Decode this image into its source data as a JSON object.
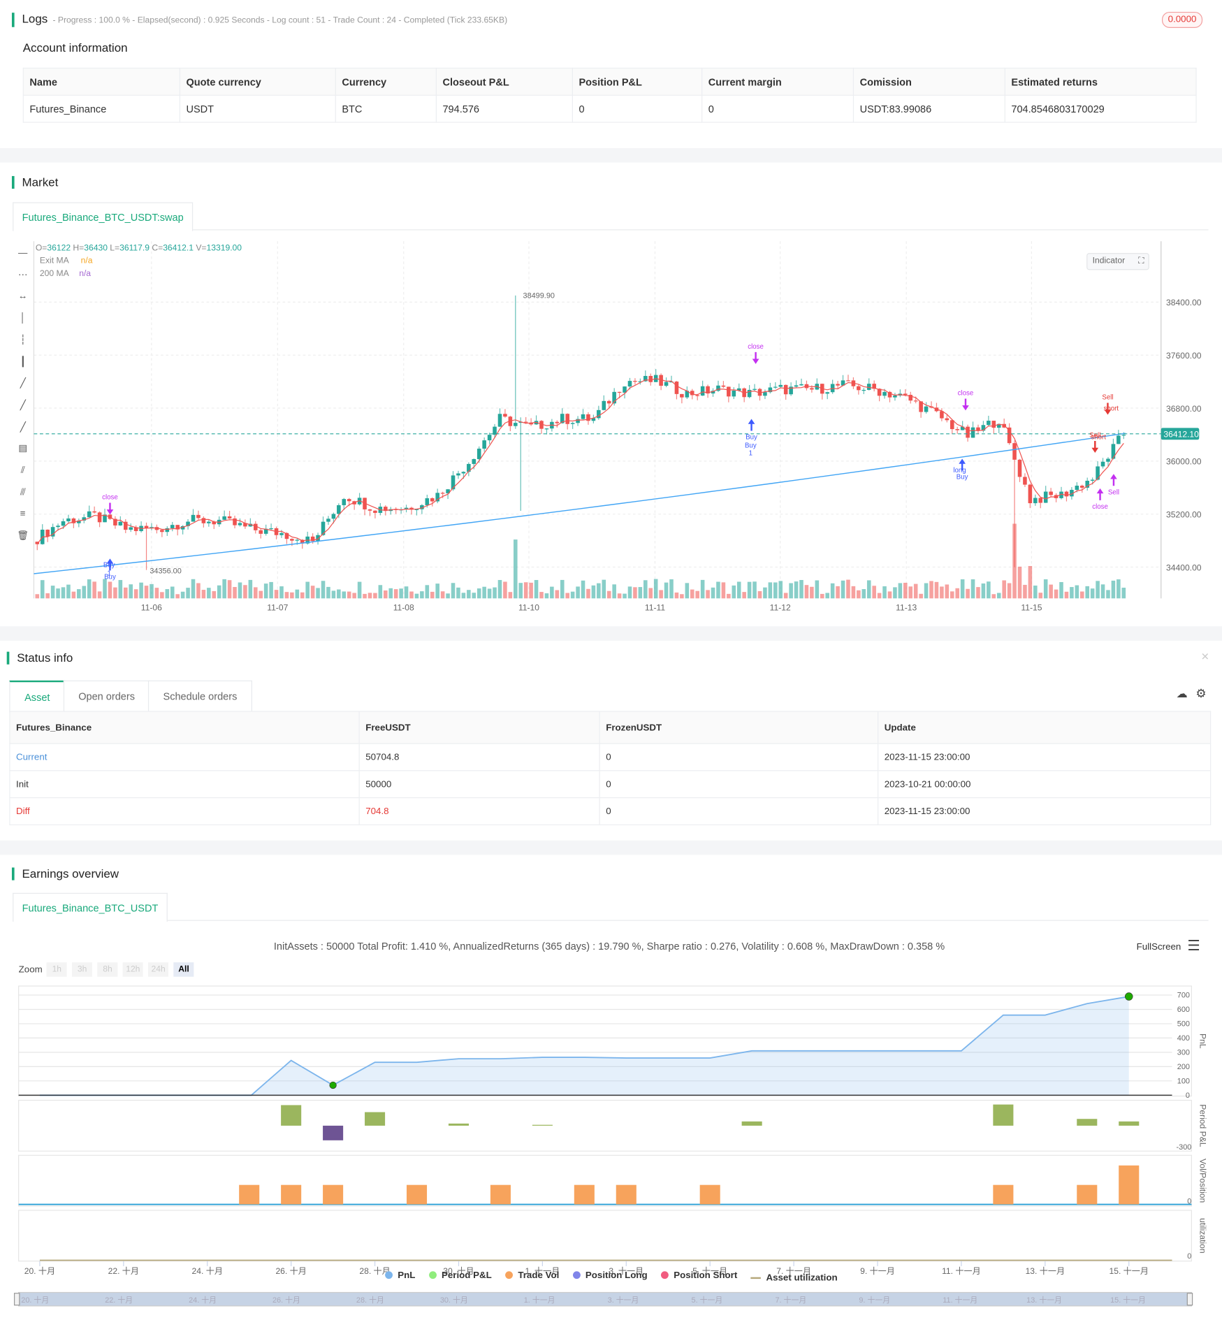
{
  "logs": {
    "title": "Logs",
    "summary": "- Progress : 100.0 % - Elapsed(second) : 0.925  Seconds - Log count : 51 - Trade Count : 24 - Completed (Tick 233.65KB)",
    "badge": "0.0000"
  },
  "account": {
    "title": "Account information",
    "headers": [
      "Name",
      "Quote currency",
      "Currency",
      "Closeout P&L",
      "Position P&L",
      "Current margin",
      "Comission",
      "Estimated returns"
    ],
    "row": [
      "Futures_Binance",
      "USDT",
      "BTC",
      "794.576",
      "0",
      "0",
      "USDT:83.99086",
      "704.8546803170029"
    ]
  },
  "market": {
    "title": "Market",
    "tab": "Futures_Binance_BTC_USDT:swap",
    "ohlc": {
      "o_label": "O=",
      "o": "36122",
      "h_label": "H=",
      "h": "36430",
      "l_label": "L=",
      "l": "36117.9",
      "c_label": "C=",
      "c": "36412.1",
      "v_label": "V=",
      "v": "13319.00"
    },
    "legend": [
      {
        "name": "Exit MA",
        "value": "n/a",
        "color": "#f5a623"
      },
      {
        "name": "200 MA",
        "value": "n/a",
        "color": "#a66bd3"
      }
    ],
    "indicator_button": "Indicator",
    "last_price": "36412.10",
    "max_label": "38499.90",
    "min_label": "34356.00",
    "markers": [
      "Buy",
      "long",
      "1",
      "close",
      "short",
      "Sell"
    ]
  },
  "chart_data": {
    "type": "candlestick",
    "title": "Futures_Binance_BTC_USDT:swap",
    "x_ticks": [
      "11-06",
      "11-07",
      "11-08",
      "11-10",
      "11-11",
      "11-12",
      "11-13",
      "11-15"
    ],
    "y_ticks": [
      34400,
      35200,
      36000,
      36800,
      37600,
      38400
    ],
    "ylim": [
      34000,
      38900
    ],
    "closes_6h": [
      34783,
      35100,
      35167,
      34975,
      34975,
      35100,
      35100,
      34975,
      34911,
      34783,
      35486,
      35294,
      35294,
      35486,
      35997,
      36636,
      36509,
      36636,
      36636,
      37211,
      37211,
      37020,
      37084,
      37020,
      37084,
      37084,
      37148,
      37084,
      36956,
      36700,
      36381,
      36636,
      35422,
      35486,
      35742,
      36412
    ],
    "ma200_start": 34300,
    "ma200_end": 36420,
    "series": [
      {
        "name": "Exit MA",
        "color": "#ef5350"
      },
      {
        "name": "200 MA",
        "color": "#42a5f5"
      }
    ],
    "colors": {
      "up": "#26a69a",
      "down": "#ef5350"
    }
  },
  "status": {
    "title": "Status info",
    "tabs": [
      "Asset",
      "Open orders",
      "Schedule orders"
    ],
    "headers": [
      "Futures_Binance",
      "FreeUSDT",
      "FrozenUSDT",
      "Update"
    ],
    "rows": [
      [
        "Current",
        "50704.8",
        "0",
        "2023-11-15 23:00:00"
      ],
      [
        "Init",
        "50000",
        "0",
        "2023-10-21 00:00:00"
      ],
      [
        "Diff",
        "704.8",
        "0",
        "2023-11-15 23:00:00"
      ]
    ]
  },
  "earnings": {
    "title": "Earnings overview",
    "tab": "Futures_Binance_BTC_USDT",
    "summary": "InitAssets : 50000 Total Profit: 1.410 %, AnnualizedReturns (365 days) : 19.790 %, Sharpe ratio : 0.276, Volatility : 0.608 %, MaxDrawDown : 0.358 %",
    "fullscreen": "FullScreen",
    "zoom_label": "Zoom",
    "zoom_options": [
      "1h",
      "3h",
      "8h",
      "12h",
      "24h",
      "All"
    ],
    "axis_titles": [
      "PnL",
      "Period P&L",
      "Vol/Position",
      "utilization"
    ],
    "pnl_ticks": [
      "700",
      "600",
      "500",
      "400",
      "300",
      "200",
      "100",
      "0"
    ],
    "period_tick": "-300",
    "vol_tick": "0",
    "util_tick": "0",
    "x_ticks": [
      "20. 十月",
      "22. 十月",
      "24. 十月",
      "26. 十月",
      "28. 十月",
      "30. 十月",
      "1. 十一月",
      "3. 十一月",
      "5. 十一月",
      "7. 十一月",
      "9. 十一月",
      "11. 十一月",
      "13. 十一月",
      "15. 十一月"
    ],
    "legend": [
      {
        "name": "PnL",
        "color": "#7cb5ec"
      },
      {
        "name": "Period P&L",
        "color": "#90ed7d"
      },
      {
        "name": "Trade Vol",
        "color": "#f7a35c"
      },
      {
        "name": "Position Long",
        "color": "#8085e9"
      },
      {
        "name": "Position Short",
        "color": "#f15c80"
      },
      {
        "name": "Asset utilization",
        "color": "#b5a77a"
      }
    ]
  },
  "earnings_chart": {
    "type": "line",
    "pnl": {
      "days": [
        0,
        1,
        2,
        3,
        4,
        5,
        5.05,
        6,
        7,
        8,
        9,
        10,
        11,
        12,
        13,
        14,
        15,
        16,
        17,
        18,
        19,
        20,
        21,
        22,
        23,
        24,
        25,
        26
      ],
      "values": [
        0,
        0,
        0,
        0,
        0,
        0,
        0,
        243,
        70,
        230,
        230,
        255,
        255,
        265,
        265,
        260,
        260,
        260,
        310,
        310,
        310,
        310,
        310,
        310,
        560,
        560,
        640,
        690
      ]
    },
    "period": {
      "days": [
        6,
        7,
        8,
        10,
        12,
        17,
        23,
        25,
        26
      ],
      "values": [
        243,
        -173,
        160,
        25,
        10,
        50,
        250,
        80,
        50
      ]
    },
    "vol": {
      "days": [
        5,
        6,
        7,
        9,
        11,
        13,
        14,
        16,
        23,
        25,
        26
      ],
      "values": [
        1,
        1,
        1,
        1,
        1,
        1,
        1,
        1,
        1,
        1,
        2
      ]
    }
  }
}
